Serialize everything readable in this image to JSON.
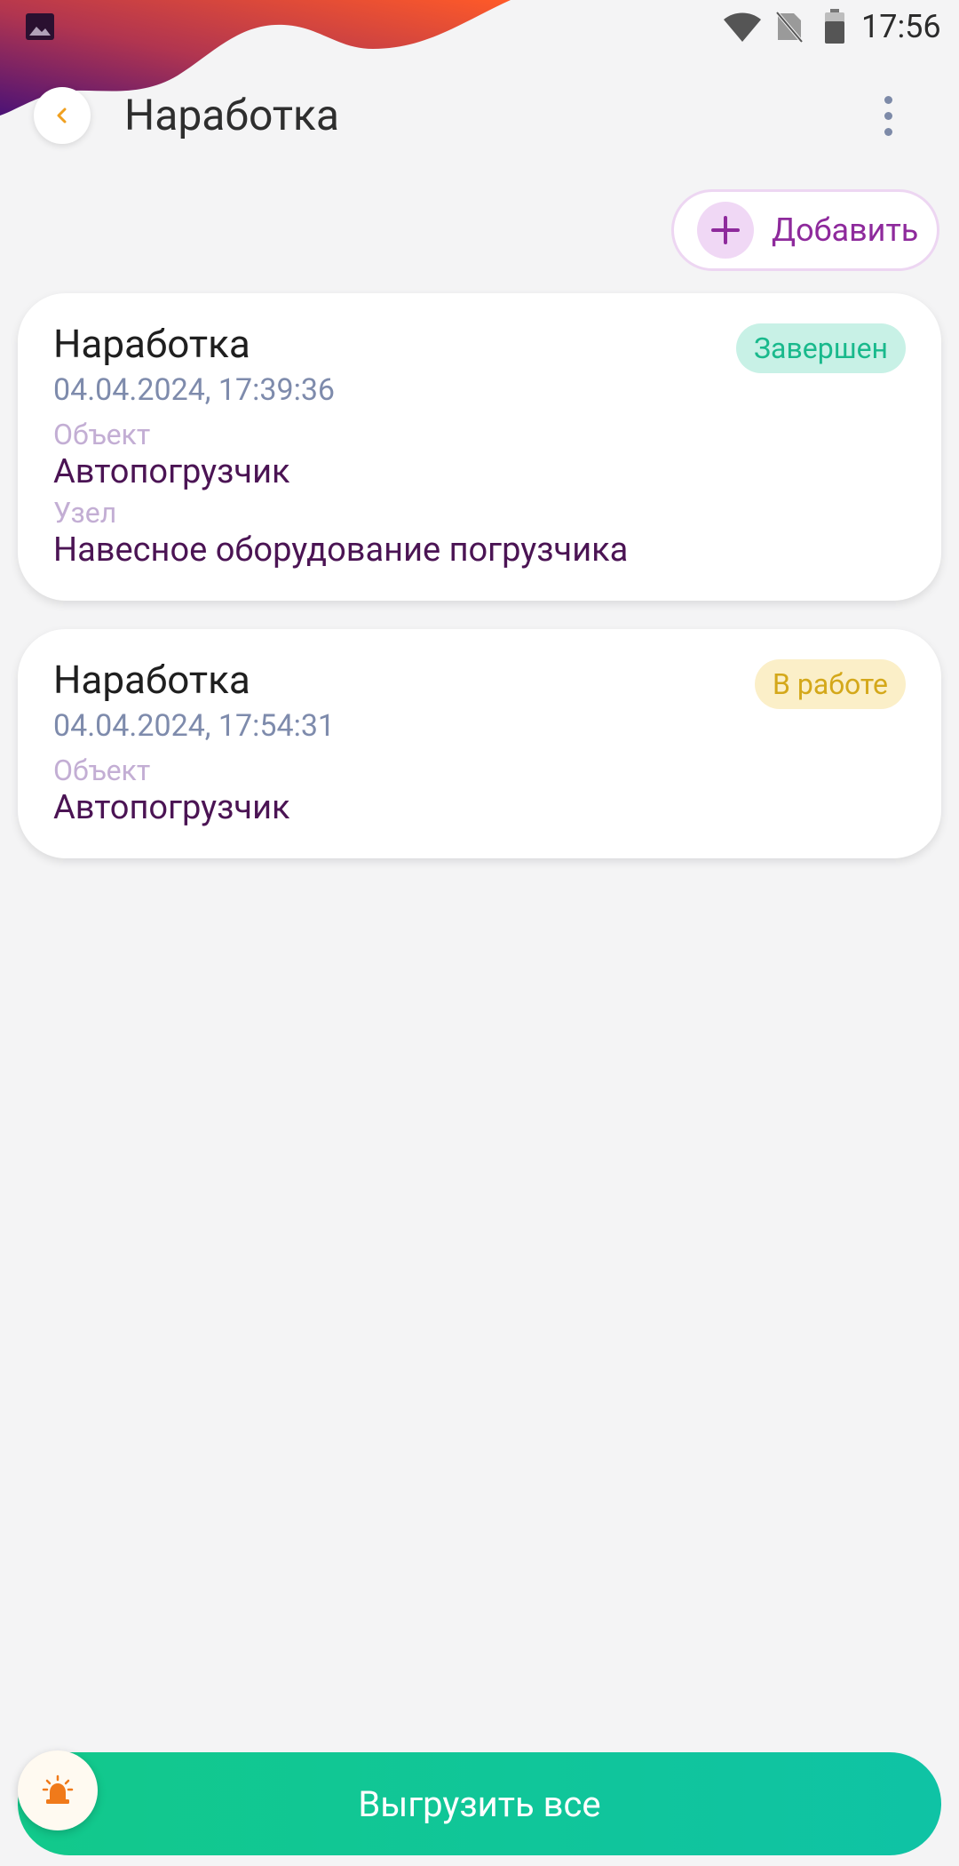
{
  "status_bar": {
    "time": "17:56",
    "icons": [
      "gallery-icon",
      "wifi-icon",
      "no-sim-icon",
      "battery-icon"
    ]
  },
  "header": {
    "title": "Наработка",
    "back_icon": "chevron-left-icon",
    "menu_icon": "more-vertical-icon"
  },
  "actions": {
    "add_label": "Добавить",
    "add_icon": "plus-icon"
  },
  "records": [
    {
      "title": "Наработка",
      "date": "04.04.2024, 17:39:36",
      "status": "Завершен",
      "object_label": "Объект",
      "object_value": "Автопогрузчик",
      "node_label": "Узел",
      "node_value": "Навесное оборудование погрузчика"
    },
    {
      "title": "Наработка",
      "date": "04.04.2024, 17:54:31",
      "status": "В работе",
      "object_label": "Объект",
      "object_value": "Автопогрузчик"
    }
  ],
  "footer": {
    "upload_label": "Выгрузить все",
    "alarm_icon": "siren-icon"
  },
  "colors": {
    "background": "#f4f4f5",
    "accent_purple": "#8e2a9c",
    "status_done_text": "#19b98c",
    "status_done_bg": "#c8f1e6",
    "status_work_text": "#d4a81a",
    "status_work_bg": "#fbefc8",
    "upload_green": "#12c98b",
    "back_icon_orange": "#f0a020"
  }
}
